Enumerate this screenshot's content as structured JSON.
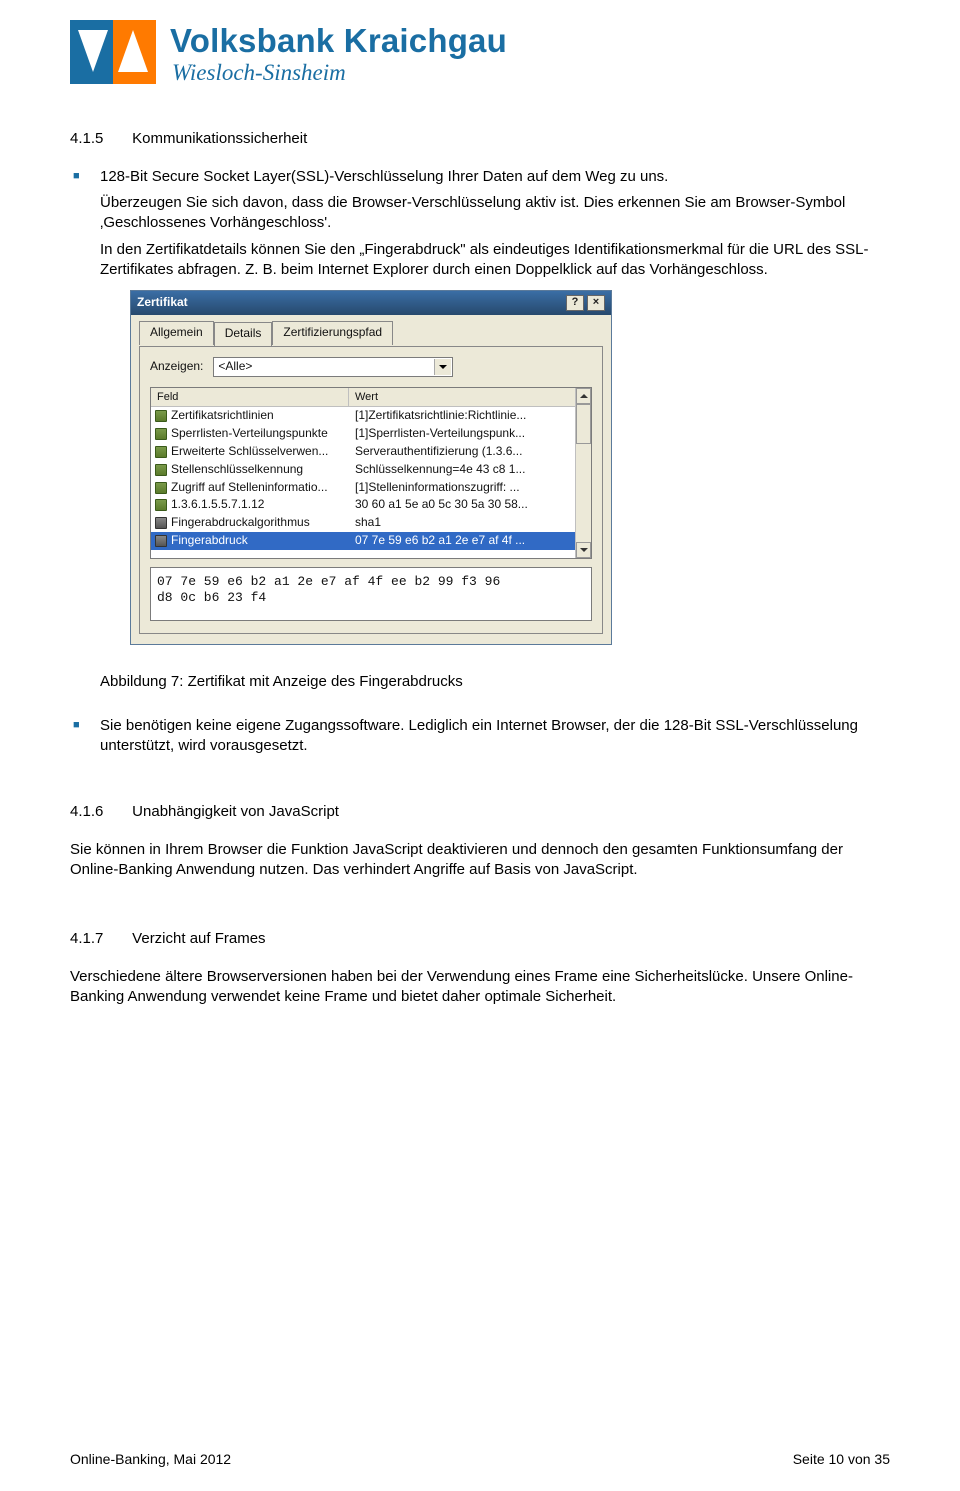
{
  "brand": {
    "main": "Volksbank Kraichgau",
    "sub": "Wiesloch-Sinsheim"
  },
  "sec_415": {
    "num": "4.1.5",
    "title": "Kommunikationssicherheit"
  },
  "bullet_1": "128-Bit Secure Socket Layer(SSL)-Verschlüsselung Ihrer Daten auf dem Weg zu uns.",
  "bullet_1_p1": "Überzeugen Sie sich davon, dass die Browser-Verschlüsselung aktiv ist. Dies erkennen Sie am Browser-Symbol ‚Geschlossenes Vorhängeschloss'.",
  "bullet_1_p2": "In den Zertifikatdetails können Sie den „Fingerabdruck\" als eindeutiges Identifikationsmerkmal für die URL des SSL-Zertifikates abfragen. Z. B. beim Internet Explorer durch einen Doppelklick auf das Vorhängeschloss.",
  "dialog": {
    "title": "Zertifikat",
    "tabs": [
      "Allgemein",
      "Details",
      "Zertifizierungspfad"
    ],
    "anzeigen_label": "Anzeigen:",
    "anzeigen_value": "<Alle>",
    "col_feld": "Feld",
    "col_wert": "Wert",
    "rows": [
      {
        "f": "Zertifikatsrichtlinien",
        "w": "[1]Zertifikatsrichtlinie:Richtlinie..."
      },
      {
        "f": "Sperrlisten-Verteilungspunkte",
        "w": "[1]Sperrlisten-Verteilungspunk..."
      },
      {
        "f": "Erweiterte Schlüsselverwen...",
        "w": "Serverauthentifizierung (1.3.6..."
      },
      {
        "f": "Stellenschlüsselkennung",
        "w": "Schlüsselkennung=4e 43 c8 1..."
      },
      {
        "f": "Zugriff auf Stelleninformatio...",
        "w": "[1]Stelleninformationszugriff: ..."
      },
      {
        "f": "1.3.6.1.5.5.7.1.12",
        "w": "30 60 a1 5e a0 5c 30 5a 30 58..."
      },
      {
        "f": "Fingerabdruckalgorithmus",
        "w": "sha1"
      },
      {
        "f": "Fingerabdruck",
        "w": "07 7e 59 e6 b2 a1 2e e7 af 4f ..."
      }
    ],
    "detail": "07 7e 59 e6 b2 a1 2e e7 af 4f ee b2 99 f3 96\nd8 0c b6 23 f4"
  },
  "fig_caption": "Abbildung 7: Zertifikat mit Anzeige des Fingerabdrucks",
  "bullet_2_a": "Sie benötigen keine eigene Zugangssoftware. Lediglich ein Internet Browser, der die 128-Bit SSL-Verschlüsselung unterstützt, wird vorausgesetzt.",
  "sec_416": {
    "num": "4.1.6",
    "title": "Unabhängigkeit von JavaScript"
  },
  "p_416": "Sie können in Ihrem Browser die Funktion JavaScript deaktivieren und dennoch den gesamten Funktionsumfang der Online-Banking Anwendung nutzen. Das verhindert Angriffe auf Basis von JavaScript.",
  "sec_417": {
    "num": "4.1.7",
    "title": "Verzicht auf Frames"
  },
  "p_417": "Verschiedene ältere Browserversionen haben bei der Verwendung eines Frame eine Sicherheitslücke. Unsere Online-Banking Anwendung verwendet keine Frame und bietet daher optimale Sicherheit.",
  "footer": {
    "left": "Online-Banking, Mai 2012",
    "right": "Seite 10 von 35"
  }
}
